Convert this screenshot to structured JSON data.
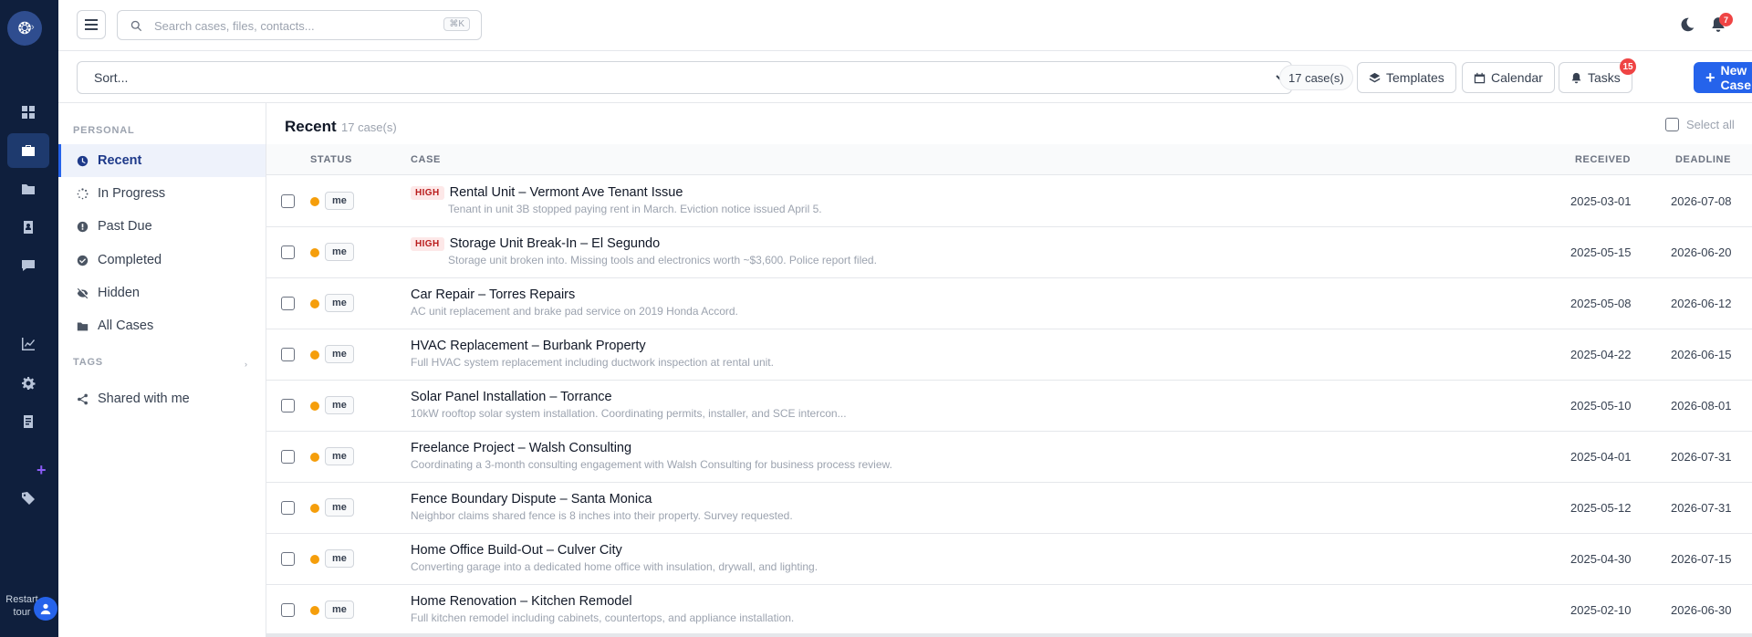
{
  "app": {
    "logo_glyph": "❂",
    "logo_arrow": "›",
    "restart_tour": "Restart tour"
  },
  "rail": {
    "items": [
      {
        "icon": "dashboard-icon"
      },
      {
        "icon": "briefcase-icon",
        "active": true
      },
      {
        "icon": "folder-icon"
      },
      {
        "icon": "contact-book-icon"
      },
      {
        "icon": "chat-icon"
      },
      {
        "icon": "chart-line-icon"
      },
      {
        "icon": "gear-icon"
      },
      {
        "icon": "document-icon"
      },
      {
        "icon": "tag-icon"
      }
    ],
    "add_glyph": "+"
  },
  "header": {
    "search": {
      "placeholder": "Search cases, files, contacts...",
      "shortcut": "⌘K"
    },
    "notifications_count": "7"
  },
  "toolbar": {
    "sort_placeholder": "Sort...",
    "case_count": "17 case(s)",
    "templates": "Templates",
    "calendar": "Calendar",
    "tasks": "Tasks",
    "tasks_badge": "15",
    "new_case": "New Case",
    "new_case_plus": "+"
  },
  "side": {
    "personal_label": "PERSONAL",
    "items": [
      {
        "label": "Recent",
        "icon": "clock-icon",
        "active": true
      },
      {
        "label": "In Progress",
        "icon": "spinner-icon"
      },
      {
        "label": "Past Due",
        "icon": "alert-circle-icon"
      },
      {
        "label": "Completed",
        "icon": "check-circle-icon"
      },
      {
        "label": "Hidden",
        "icon": "eye-slash-icon"
      },
      {
        "label": "All Cases",
        "icon": "folder-icon"
      }
    ],
    "tags_label": "TAGS",
    "tags_chevron": "›",
    "shared": {
      "label": "Shared with me",
      "icon": "share-icon"
    }
  },
  "list": {
    "title": "Recent",
    "count": "17 case(s)",
    "select_all": "Select all",
    "columns": {
      "status": "STATUS",
      "case": "CASE",
      "received": "RECEIVED",
      "deadline": "DEADLINE"
    },
    "rows": [
      {
        "status": "me",
        "priority": "HIGH",
        "title": "Rental Unit – Vermont Ave Tenant Issue",
        "desc": "Tenant in unit 3B stopped paying rent in March. Eviction notice issued April 5.",
        "received": "2025-03-01",
        "deadline": "2026-07-08"
      },
      {
        "status": "me",
        "priority": "HIGH",
        "title": "Storage Unit Break-In – El Segundo",
        "desc": "Storage unit broken into. Missing tools and electronics worth ~$3,600. Police report filed.",
        "received": "2025-05-15",
        "deadline": "2026-06-20"
      },
      {
        "status": "me",
        "priority": "",
        "title": "Car Repair – Torres Repairs",
        "desc": "AC unit replacement and brake pad service on 2019 Honda Accord.",
        "received": "2025-05-08",
        "deadline": "2026-06-12"
      },
      {
        "status": "me",
        "priority": "",
        "title": "HVAC Replacement – Burbank Property",
        "desc": "Full HVAC system replacement including ductwork inspection at rental unit.",
        "received": "2025-04-22",
        "deadline": "2026-06-15"
      },
      {
        "status": "me",
        "priority": "",
        "title": "Solar Panel Installation – Torrance",
        "desc": "10kW rooftop solar system installation. Coordinating permits, installer, and SCE intercon...",
        "received": "2025-05-10",
        "deadline": "2026-08-01"
      },
      {
        "status": "me",
        "priority": "",
        "title": "Freelance Project – Walsh Consulting",
        "desc": "Coordinating a 3-month consulting engagement with Walsh Consulting for business process review.",
        "received": "2025-04-01",
        "deadline": "2026-07-31"
      },
      {
        "status": "me",
        "priority": "",
        "title": "Fence Boundary Dispute – Santa Monica",
        "desc": "Neighbor claims shared fence is 8 inches into their property. Survey requested.",
        "received": "2025-05-12",
        "deadline": "2026-07-31"
      },
      {
        "status": "me",
        "priority": "",
        "title": "Home Office Build-Out – Culver City",
        "desc": "Converting garage into a dedicated home office with insulation, drywall, and lighting.",
        "received": "2025-04-30",
        "deadline": "2026-07-15"
      },
      {
        "status": "me",
        "priority": "",
        "title": "Home Renovation – Kitchen Remodel",
        "desc": "Full kitchen remodel including cabinets, countertops, and appliance installation.",
        "received": "2025-02-10",
        "deadline": "2026-06-30"
      }
    ]
  },
  "colors": {
    "rail_bg": "#0f1f3d",
    "accent": "#2563eb",
    "status_dot": "#f59e0b",
    "badge_red": "#ef4444",
    "priority_text": "#b91c1c"
  }
}
